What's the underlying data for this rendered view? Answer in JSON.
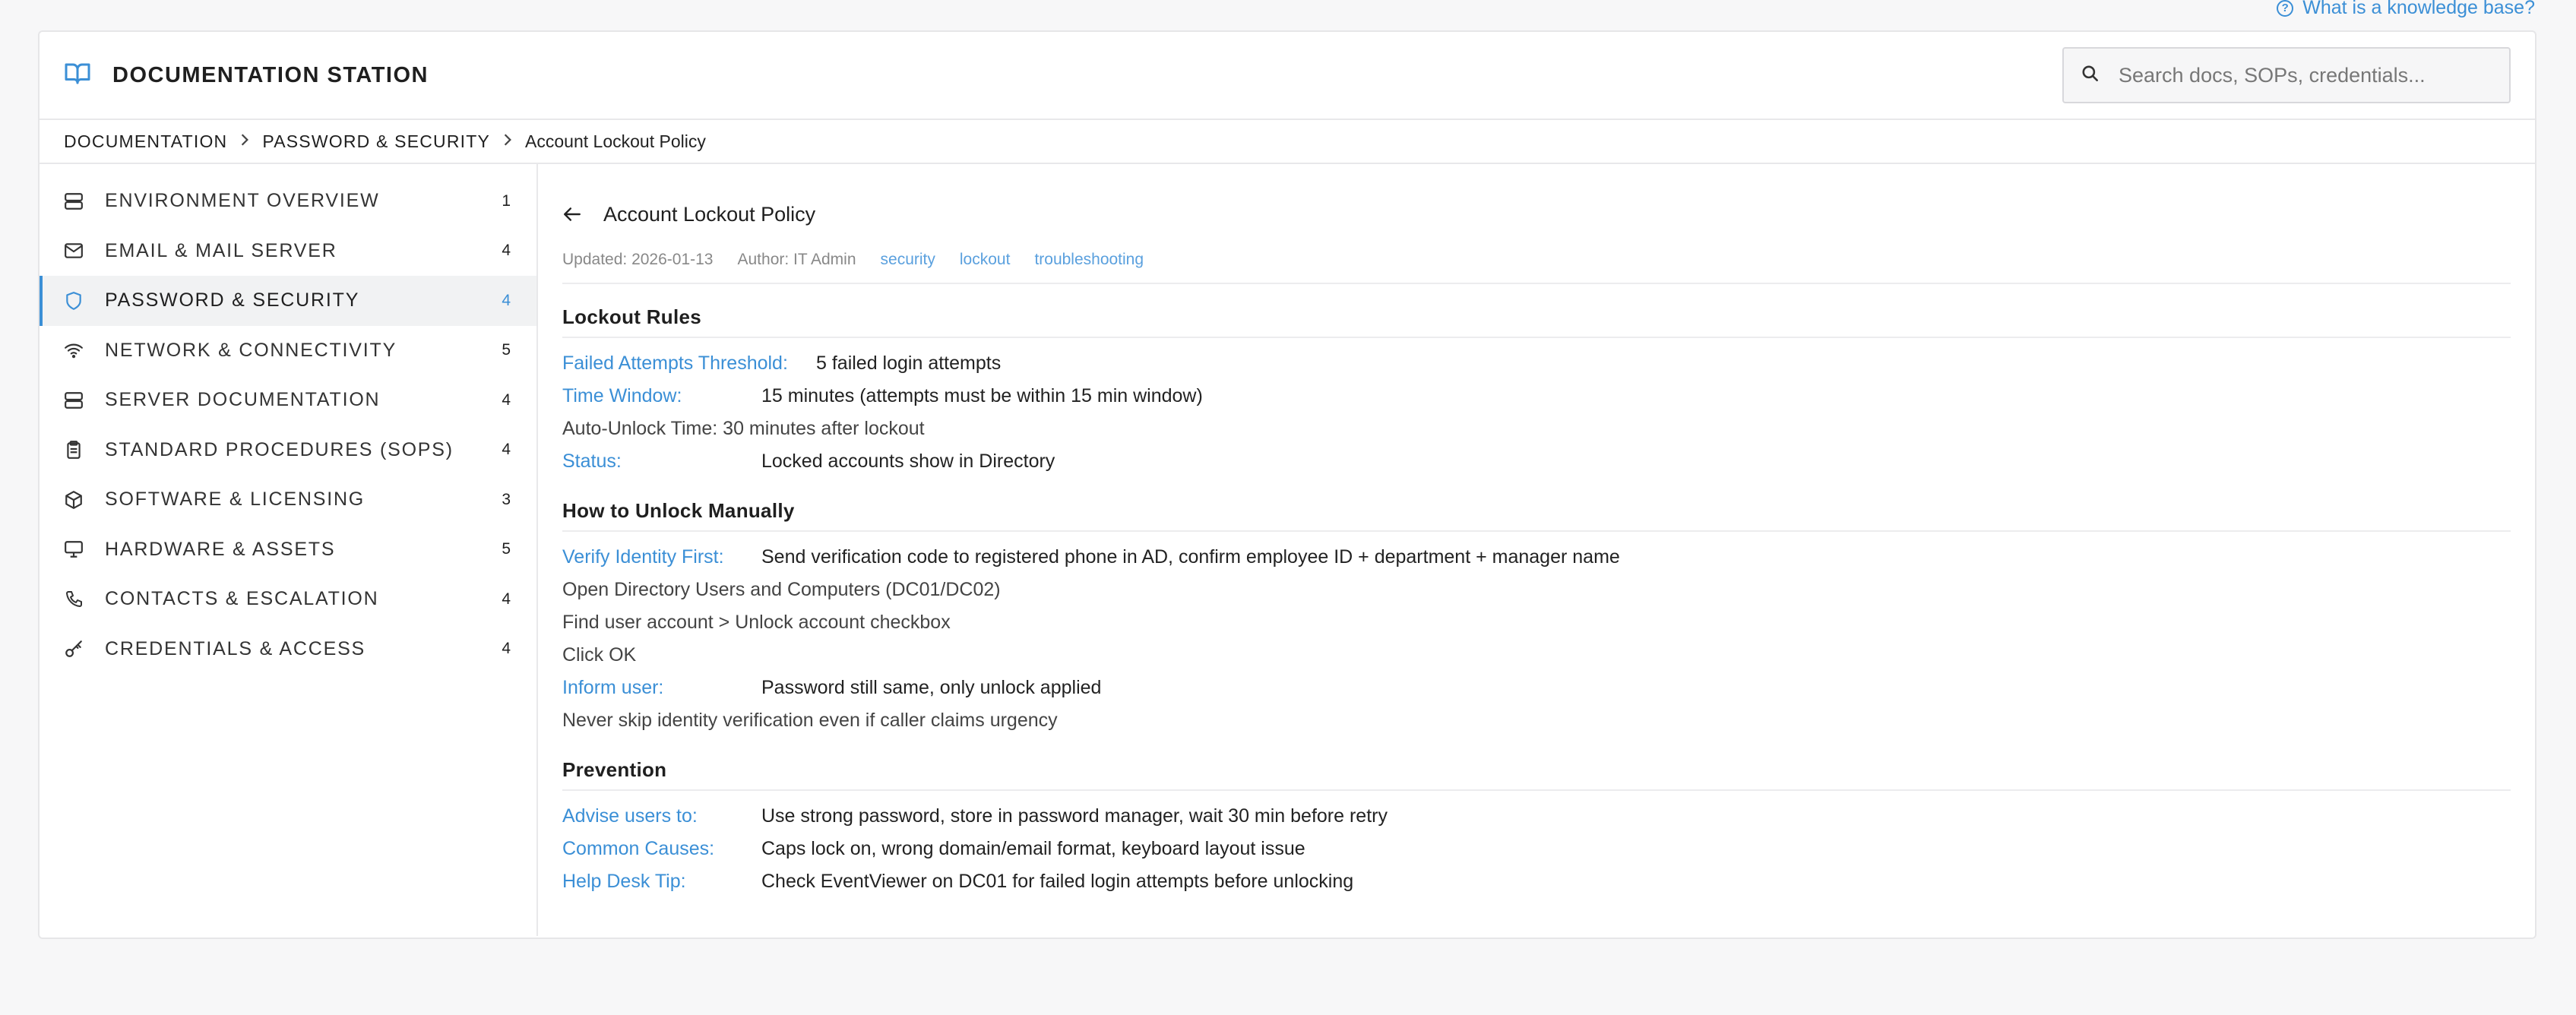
{
  "top_link": {
    "label": "What is a knowledge base?"
  },
  "header": {
    "title": "DOCUMENTATION STATION",
    "search_placeholder": "Search docs, SOPs, credentials..."
  },
  "breadcrumb": {
    "items": [
      "DOCUMENTATION",
      "PASSWORD & SECURITY"
    ],
    "current": "Account Lockout Policy"
  },
  "sidebar": {
    "items": [
      {
        "label": "ENVIRONMENT OVERVIEW",
        "count": "1",
        "icon": "server-icon"
      },
      {
        "label": "EMAIL & MAIL SERVER",
        "count": "4",
        "icon": "mail-icon"
      },
      {
        "label": "PASSWORD & SECURITY",
        "count": "4",
        "icon": "shield-icon",
        "active": true
      },
      {
        "label": "NETWORK & CONNECTIVITY",
        "count": "5",
        "icon": "wifi-icon"
      },
      {
        "label": "SERVER DOCUMENTATION",
        "count": "4",
        "icon": "server-icon"
      },
      {
        "label": "STANDARD PROCEDURES (SOPS)",
        "count": "4",
        "icon": "clipboard-icon"
      },
      {
        "label": "SOFTWARE & LICENSING",
        "count": "3",
        "icon": "package-icon"
      },
      {
        "label": "HARDWARE & ASSETS",
        "count": "5",
        "icon": "monitor-icon"
      },
      {
        "label": "CONTACTS & ESCALATION",
        "count": "4",
        "icon": "phone-icon"
      },
      {
        "label": "CREDENTIALS & ACCESS",
        "count": "4",
        "icon": "key-icon"
      }
    ]
  },
  "doc": {
    "title": "Account Lockout Policy",
    "updated": "Updated: 2026-01-13",
    "author": "Author: IT Admin",
    "tags": [
      "security",
      "lockout",
      "troubleshooting"
    ],
    "sections": {
      "lockout": {
        "title": "Lockout Rules",
        "r1_k": "Failed Attempts Threshold:",
        "r1_v": "5 failed login attempts",
        "r2_k": "Time Window:",
        "r2_v": "15 minutes (attempts must be within 15 min window)",
        "r3": "Auto-Unlock Time: 30 minutes after lockout",
        "r4_k": "Status:",
        "r4_v": "Locked accounts show in Directory"
      },
      "unlock": {
        "title": "How to Unlock Manually",
        "r1_k": "Verify Identity First:",
        "r1_v": "Send verification code to registered phone in AD, confirm employee ID + department + manager name",
        "r2": "Open Directory Users and Computers (DC01/DC02)",
        "r3": "Find user account > Unlock account checkbox",
        "r4": "Click OK",
        "r5_k": "Inform user:",
        "r5_v": "Password still same, only unlock applied",
        "r6": "Never skip identity verification even if caller claims urgency"
      },
      "prevention": {
        "title": "Prevention",
        "r1_k": "Advise users to:",
        "r1_v": "Use strong password, store in password manager, wait 30 min before retry",
        "r2_k": "Common Causes:",
        "r2_v": "Caps lock on, wrong domain/email format, keyboard layout issue",
        "r3_k": "Help Desk Tip:",
        "r3_v": "Check EventViewer on DC01 for failed login attempts before unlocking"
      }
    }
  },
  "colors": {
    "accent": "#3b8fd6",
    "text": "#2a2a2a",
    "border": "#e8e8ea"
  }
}
